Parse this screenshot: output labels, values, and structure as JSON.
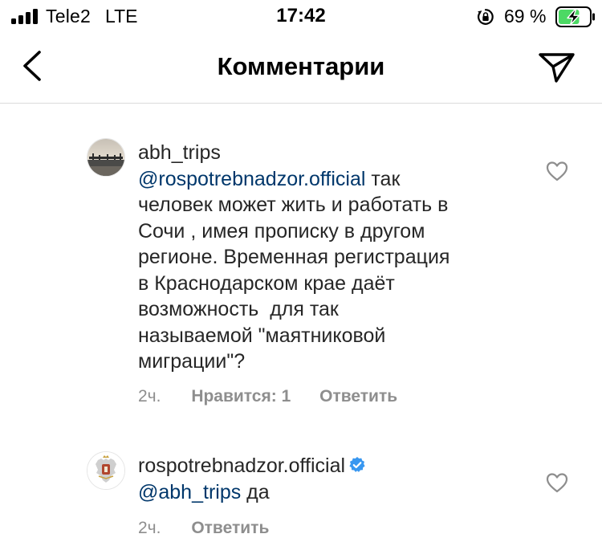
{
  "status_bar": {
    "carrier": "Tele2",
    "network": "LTE",
    "time": "17:42",
    "battery_percent": "69 %",
    "battery_level": 0.69,
    "charging": true
  },
  "header": {
    "title": "Комментарии"
  },
  "comments": [
    {
      "username": "abh_trips",
      "mention": "@rospotrebnadzor.official",
      "text_lines": [
        " так",
        "человек может жить и работать в",
        "Сочи , имея прописку в другом",
        "регионе. Временная регистрация",
        "в Краснодарском крае даёт",
        "возможность  для так",
        "называемой \"маятниковой",
        "миграции\"?"
      ],
      "time": "2ч.",
      "likes": "Нравится: 1",
      "reply": "Ответить"
    },
    {
      "username": "rospotrebnadzor.official",
      "verified": true,
      "mention": "@abh_trips",
      "text": " да",
      "time": "2ч.",
      "reply": "Ответить"
    }
  ],
  "colors": {
    "mention": "#00376b",
    "meta": "#8e8e8e",
    "verified": "#3897f0",
    "battery_fill": "#4cd964"
  }
}
